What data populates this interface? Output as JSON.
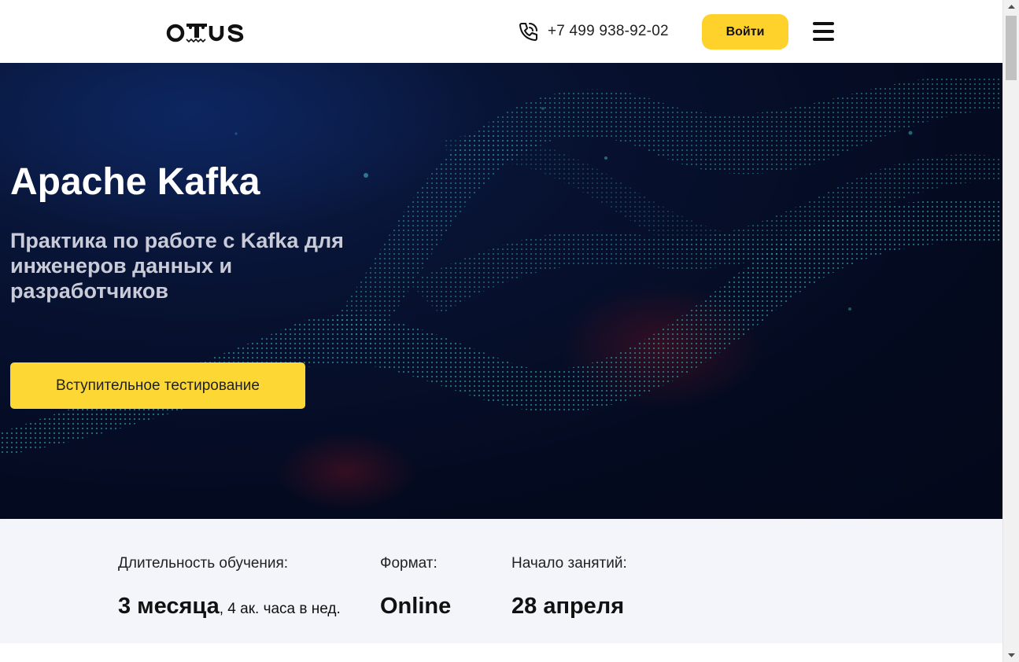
{
  "header": {
    "logo_text": "otus",
    "phone": "+7 499 938-92-02",
    "login_label": "Войти"
  },
  "hero": {
    "title": "Apache Kafka",
    "subtitle": "Практика по работе с Kafka для инженеров данных и разработчиков",
    "cta_label": "Вступительное тестирование"
  },
  "info": {
    "duration_label": "Длительность обучения:",
    "duration_value": "3 месяца",
    "duration_extra": ", 4 ак. часа в нед.",
    "format_label": "Формат:",
    "format_value": "Online",
    "start_label": "Начало занятий:",
    "start_value": "28 апреля"
  },
  "colors": {
    "accent": "#ffd12b",
    "hero_bg": "#040a1f",
    "info_bg": "#f4f4fb"
  },
  "icons": [
    "phone-icon",
    "menu-icon",
    "chevron-up-icon",
    "chevron-down-icon"
  ]
}
